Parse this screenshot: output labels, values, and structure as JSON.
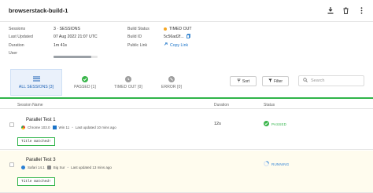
{
  "header": {
    "title": "browserstack-build-1",
    "download_icon": "download-icon",
    "delete_icon": "trash-icon",
    "more_icon": "more-vertical-icon"
  },
  "meta": {
    "sessions_label": "Sessions",
    "sessions_value": "3 · SESSIONS",
    "last_updated_label": "Last Updated",
    "last_updated_value": "07 Aug 2022 21:07 UTC",
    "duration_label": "Duration",
    "duration_value": "1m 41s",
    "user_label": "User",
    "user_progress": 0.85,
    "build_status_label": "Build Status",
    "build_status_value": "TIMED OUT",
    "build_id_label": "Build ID",
    "build_id_value": "5c56ad2f...",
    "public_link_label": "Public Link",
    "copy_link_label": "Copy Link",
    "status_color": "#f5a623"
  },
  "filters": {
    "tabs": [
      {
        "label": "ALL SESSIONS [3]",
        "icon": "list-icon"
      },
      {
        "label": "PASSED [1]",
        "icon": "check-circle-icon"
      },
      {
        "label": "TIMED OUT [0]",
        "icon": "clock-icon"
      },
      {
        "label": "ERROR [0]",
        "icon": "error-circle-icon"
      }
    ],
    "sort_label": "Sort",
    "filter_label": "Filter",
    "search_placeholder": "Search"
  },
  "table": {
    "headers": {
      "session": "Session Name",
      "duration": "Duration",
      "status": "Status"
    },
    "rows": [
      {
        "name": "Parallel Test 1",
        "browser": "Chrome 103.0",
        "os": "Win 11",
        "updated": "Last updated 10 mins ago",
        "assertion": "Title matched!",
        "duration": "12s",
        "status": "PASSED"
      },
      {
        "name": "Parallel Test 3",
        "browser": "Safari 14.1",
        "os": "Big Sur",
        "updated": "Last updated 13 mins ago",
        "assertion": "Title matched!",
        "duration": "",
        "status": "RUNNING"
      }
    ]
  },
  "colors": {
    "accent_blue": "#1a73c8",
    "pass_green": "#2fb449",
    "running_blue": "#2a7fd4",
    "timed_out_orange": "#f5a623"
  }
}
